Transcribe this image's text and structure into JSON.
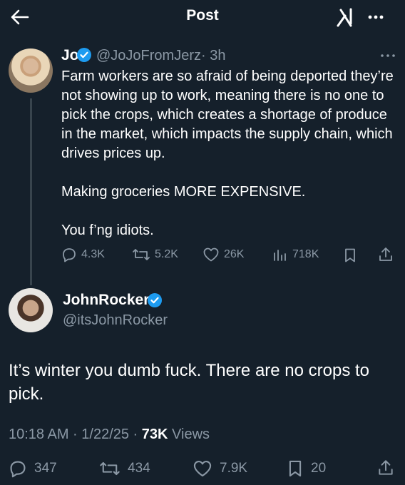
{
  "header": {
    "title": "Post"
  },
  "parent_tweet": {
    "name": "Jo",
    "handle": "@JoJoFromJerz",
    "time": "· 3h",
    "text": "Farm workers are so afraid of being deported they’re not showing up to work, meaning there is no one to pick the crops, which creates a shortage of produce in the market, which impacts the supply chain, which drives prices up.\n\nMaking groceries MORE EXPENSIVE.\n\nYou f’ng idiots.",
    "replies": "4.3K",
    "reposts": "5.2K",
    "likes": "26K",
    "views": "718K"
  },
  "main_tweet": {
    "name": "JohnRocker",
    "handle": "@itsJohnRocker",
    "text": "It’s winter you dumb fuck. There are no crops to pick.",
    "timestamp": "10:18 AM · 1/22/25 · ",
    "views_count": "73K",
    "views_label": " Views",
    "replies": "347",
    "reposts": "434",
    "likes": "7.9K",
    "bookmarks": "20"
  },
  "colors": {
    "background": "#15202b",
    "verified": "#1d9bf0",
    "muted": "#8b98a5"
  }
}
